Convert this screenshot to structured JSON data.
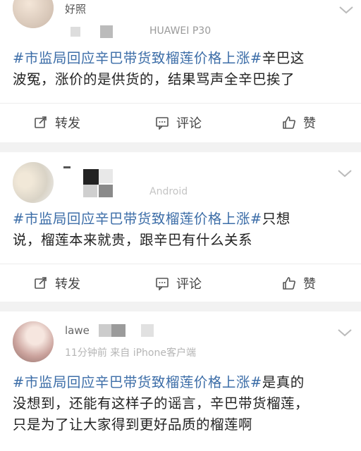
{
  "posts": [
    {
      "username": "好照",
      "source": "HUAWEI P30",
      "hashtag": "#市监局回应辛巴带货致榴莲价格上涨#",
      "text_line1_rest": "辛巴这",
      "text_lines": [
        "波冤，涨价的是供货的，结果骂声全辛巴挨了"
      ]
    },
    {
      "username": "",
      "source": "Android",
      "hashtag": "#市监局回应辛巴带货致榴莲价格上涨#",
      "text_line1_rest": "只想",
      "text_lines": [
        "说，榴莲本来就贵，跟辛巴有什么关系"
      ]
    },
    {
      "username": "lawe",
      "source": "11分钟前 来自 iPhone客户端",
      "hashtag": "#市监局回应辛巴带货致榴莲价格上涨#",
      "text_line1_rest": "是真的",
      "text_lines": [
        "没想到，还能有这样子的谣言，辛巴带货榴莲，",
        "只是为了让大家得到更好品质的榴莲啊"
      ]
    }
  ],
  "actions": {
    "repost": "转发",
    "comment": "评论",
    "like": "赞"
  },
  "colors": {
    "hashtag": "#3d6ea8",
    "separator": "#f2f2f2"
  }
}
